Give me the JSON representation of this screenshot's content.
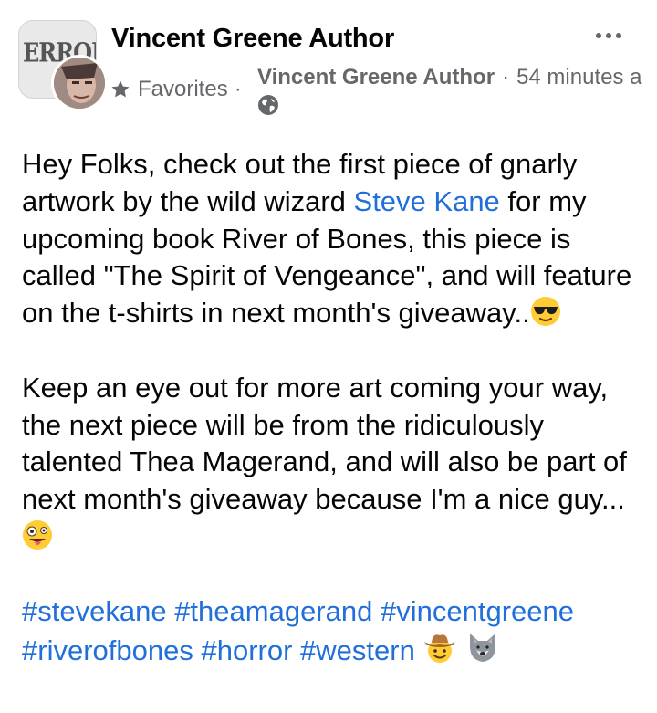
{
  "post": {
    "author": "Vincent Greene Author",
    "audience_label": "Favorites",
    "meta_separator": "·",
    "poster_name": "Vincent Greene Author",
    "time_ago": "54 minutes a",
    "page_avatar_text": "ERRON"
  },
  "body": {
    "p1_a": "Hey Folks, check out the first piece of gnarly artwork by the wild wizard ",
    "p1_link": "Steve Kane",
    "p1_b": " for my upcoming book River of Bones, this piece is called \"The Spirit of Vengeance\", and will feature on the t-shirts in next month's giveaway..",
    "p2": "Keep an eye out for more art coming your way, the next piece will be from the ridiculously talented Thea Magerand, and will also be part of next month's giveaway because I'm a nice guy...",
    "hashtags": [
      "#stevekane",
      "#theamagerand",
      "#vincentgreene",
      "#riverofbones",
      "#horror",
      "#western"
    ]
  },
  "icons": {
    "more": "more-options-icon",
    "star": "star-icon",
    "globe": "globe-icon",
    "emoji_1": "sunglasses-emoji",
    "emoji_2": "zany-face-emoji",
    "emoji_3": "cowboy-emoji",
    "emoji_4": "wolf-emoji"
  },
  "colors": {
    "text": "#050505",
    "secondary": "#65676b",
    "link": "#216fdb",
    "background": "#ffffff"
  }
}
